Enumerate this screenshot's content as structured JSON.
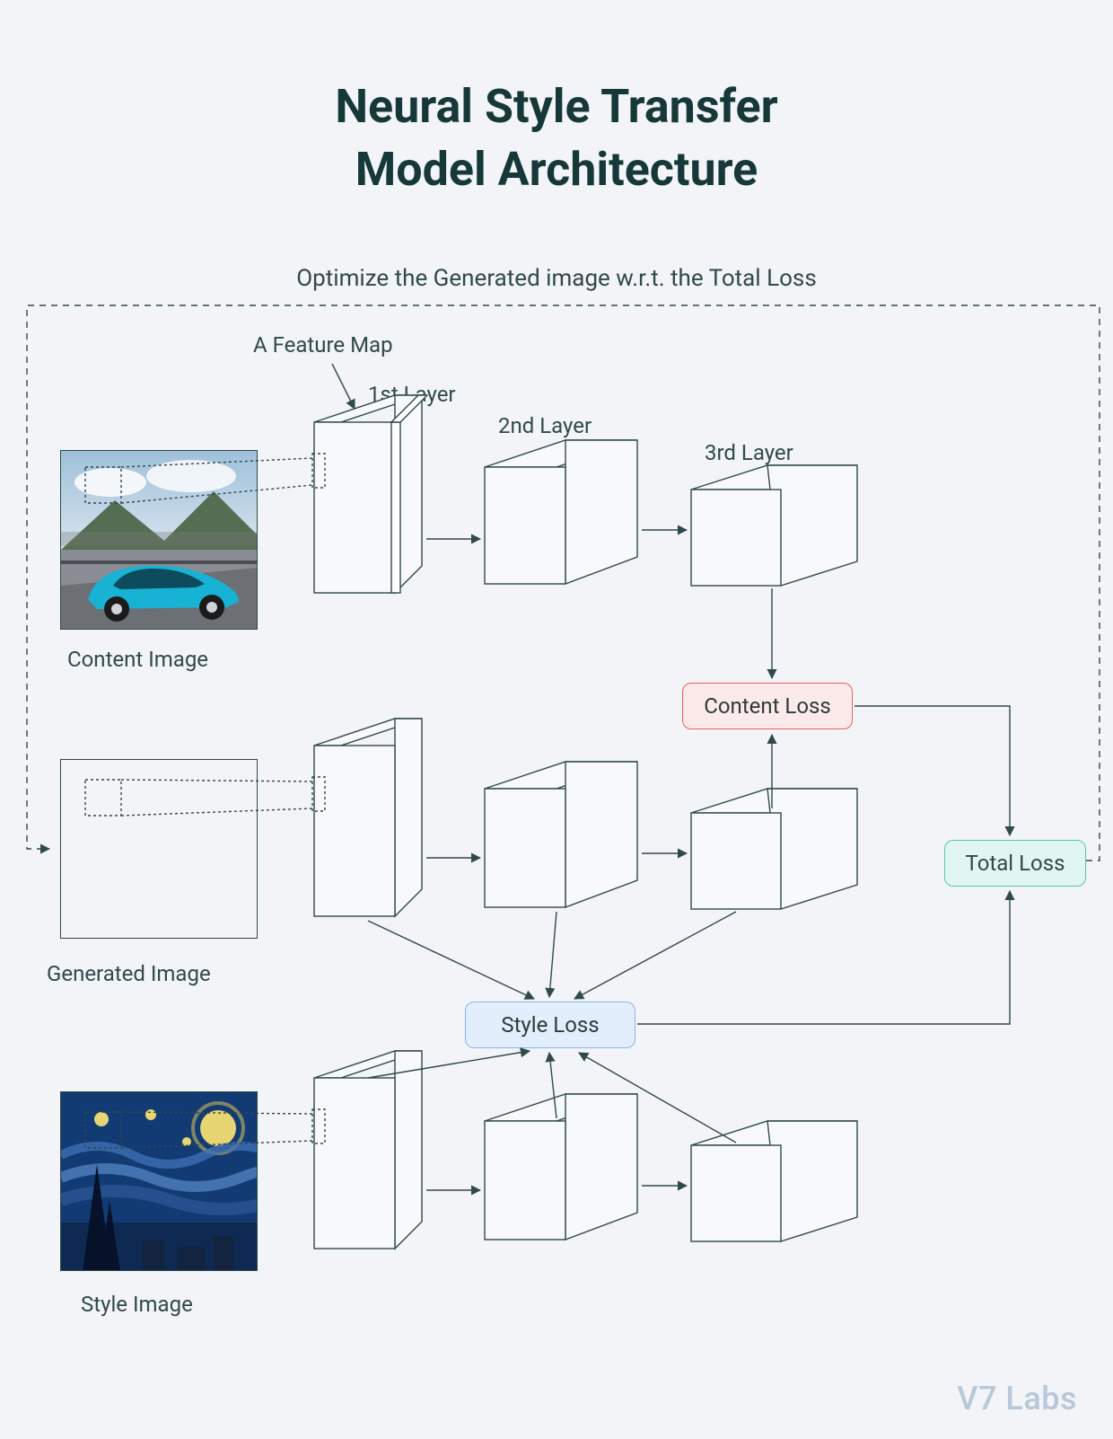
{
  "title_line1": "Neural Style Transfer",
  "title_line2": "Model Architecture",
  "optimize_caption": "Optimize the Generated image w.r.t. the Total Loss",
  "labels": {
    "feature_map": "A Feature Map",
    "layer1": "1st Layer",
    "layer2": "2nd Layer",
    "layer3": "3rd Layer",
    "content_image": "Content Image",
    "generated_image": "Generated Image",
    "style_image": "Style Image"
  },
  "losses": {
    "content": "Content Loss",
    "style": "Style Loss",
    "total": "Total Loss"
  },
  "watermark": "V7 Labs",
  "colors": {
    "bg": "#F2F4F7",
    "text": "#1E3A3A",
    "line": "#30494C",
    "content_loss_fill": "#FBEAE9",
    "content_loss_border": "#E9635D",
    "style_loss_fill": "#E2EEFB",
    "style_loss_border": "#8DB6E6",
    "total_loss_fill": "#E1F6F1",
    "total_loss_border": "#55C7B1",
    "watermark": "#B8C7DA"
  },
  "diagram": {
    "rows": [
      "content_image",
      "generated_image",
      "style_image"
    ],
    "layers_per_row": 3,
    "flow": [
      "content_row.layer3 -> content_loss",
      "generated_row.layer3 -> content_loss",
      "generated_row.all_layers -> style_loss",
      "style_row.all_layers -> style_loss",
      "content_loss -> total_loss",
      "style_loss -> total_loss",
      "total_loss -> generated_image (feedback, dashed)"
    ]
  }
}
